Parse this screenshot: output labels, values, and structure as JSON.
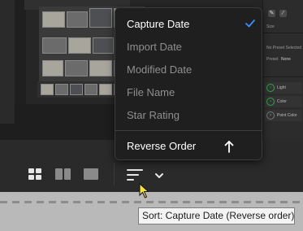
{
  "sort_menu": {
    "items": [
      {
        "label": "Capture Date",
        "selected": true
      },
      {
        "label": "Import Date",
        "selected": false
      },
      {
        "label": "Modified Date",
        "selected": false
      },
      {
        "label": "File Name",
        "selected": false
      },
      {
        "label": "Star Rating",
        "selected": false
      }
    ],
    "reverse_order": {
      "label": "Reverse Order",
      "direction_icon": "arrow-up-icon"
    },
    "check_icon": "checkmark-icon"
  },
  "toolbar": {
    "grid_view_icon": "grid-view-icon",
    "compare_view_icon": "compare-view-icon",
    "loupe_view_icon": "single-view-icon",
    "sort_icon": "sort-lines-icon",
    "sort_dropdown_icon": "chevron-down-icon"
  },
  "tooltip": {
    "text": "Sort: Capture Date (Reverse order)"
  },
  "right_panel": {
    "size_label": "Size",
    "no_preset": "No Preset Selected",
    "preset_label": "Preset",
    "preset_value": "None",
    "sections": [
      "Light",
      "Color",
      "Point Color"
    ]
  },
  "colors": {
    "accent_blue": "#3b8cff",
    "section_green": "#2fa84e",
    "menu_bg": "#1f1f1f",
    "tooltip_bg": "#f3f3f3"
  }
}
